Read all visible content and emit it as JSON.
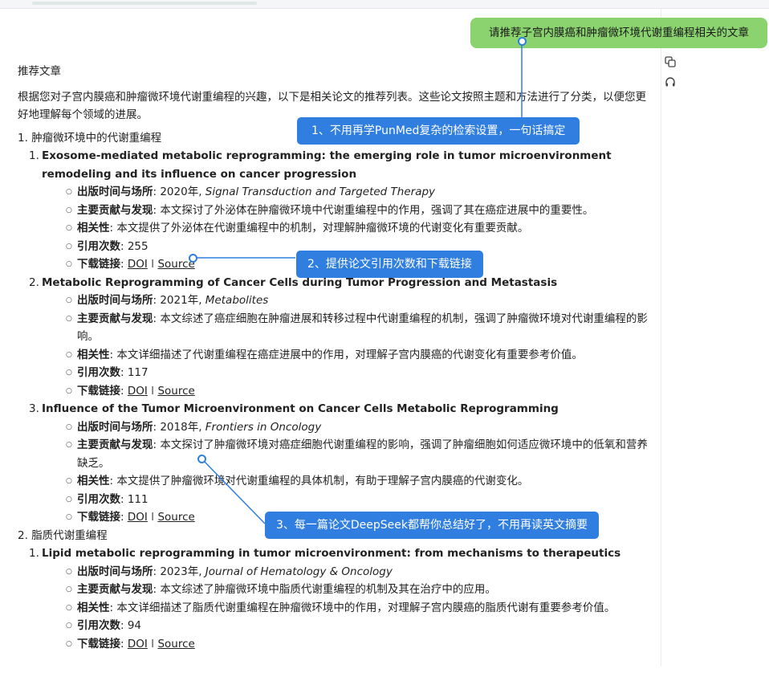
{
  "user_message": "请推荐子宫内膜癌和肿瘤微环境代谢重编程相关的文章",
  "side_icons": [
    "copy-icon",
    "headphones-icon"
  ],
  "article": {
    "heading": "推荐文章",
    "intro": "根据您对子宫内膜癌和肿瘤微环境代谢重编程的兴趣，以下是相关论文的推荐列表。这些论文按照主题和方法进行了分类，以便您更好地理解每个领域的进展。",
    "labels": {
      "time_venue": "出版时间与场所",
      "contribution": "主要贡献与发现",
      "relevance": "相关性",
      "citations": "引用次数",
      "download": "下载链接",
      "doi": "DOI",
      "sep": "I",
      "source": "Source"
    },
    "sections": [
      {
        "num": "1.",
        "title": "肿瘤微环境中的代谢重编程",
        "papers": [
          {
            "num": "1.",
            "title": "Exosome-mediated metabolic reprogramming: the emerging role in tumor microenvironment remodeling and its influence on cancer progression",
            "year": "2020年,",
            "venue": "Signal Transduction and Targeted Therapy",
            "contribution": "本文探讨了外泌体在肿瘤微环境中代谢重编程中的作用，强调了其在癌症进展中的重要性。",
            "relevance": "本文提供了外泌体在代谢重编程中的机制，对理解肿瘤微环境的代谢变化有重要贡献。",
            "citations": "255"
          },
          {
            "num": "2.",
            "title": "Metabolic Reprogramming of Cancer Cells during Tumor Progression and Metastasis",
            "year": "2021年,",
            "venue": "Metabolites",
            "contribution": "本文综述了癌症细胞在肿瘤进展和转移过程中代谢重编程的机制，强调了肿瘤微环境对代谢重编程的影响。",
            "relevance": "本文详细描述了代谢重编程在癌症进展中的作用，对理解子宫内膜癌的代谢变化有重要参考价值。",
            "citations": "117"
          },
          {
            "num": "3.",
            "title": "Influence of the Tumor Microenvironment on Cancer Cells Metabolic Reprogramming",
            "year": "2018年,",
            "venue": "Frontiers in Oncology",
            "contribution": "本文探讨了肿瘤微环境对癌症细胞代谢重编程的影响，强调了肿瘤细胞如何适应微环境中的低氧和营养缺乏。",
            "relevance": "本文提供了肿瘤微环境对代谢重编程的具体机制，有助于理解子宫内膜癌的代谢变化。",
            "citations": "111"
          }
        ]
      },
      {
        "num": "2.",
        "title": "脂质代谢重编程",
        "papers": [
          {
            "num": "1.",
            "title": "Lipid metabolic reprogramming in tumor microenvironment: from mechanisms to therapeutics",
            "year": "2023年,",
            "venue": "Journal of Hematology & Oncology",
            "contribution": "本文综述了肿瘤微环境中脂质代谢重编程的机制及其在治疗中的应用。",
            "relevance": "本文详细描述了脂质代谢重编程在肿瘤微环境中的作用，对理解子宫内膜癌的脂质代谢有重要参考价值。",
            "citations": "94"
          }
        ]
      }
    ]
  },
  "callouts": [
    "1、不用再学PunMed复杂的检索设置，一句话搞定",
    "2、提供论文引用次数和下载链接",
    "3、每一篇论文DeepSeek都帮你总结好了，不用再读英文摘要"
  ],
  "colors": {
    "bubble": "#8ad36f",
    "callout": "#2f7ee0"
  }
}
